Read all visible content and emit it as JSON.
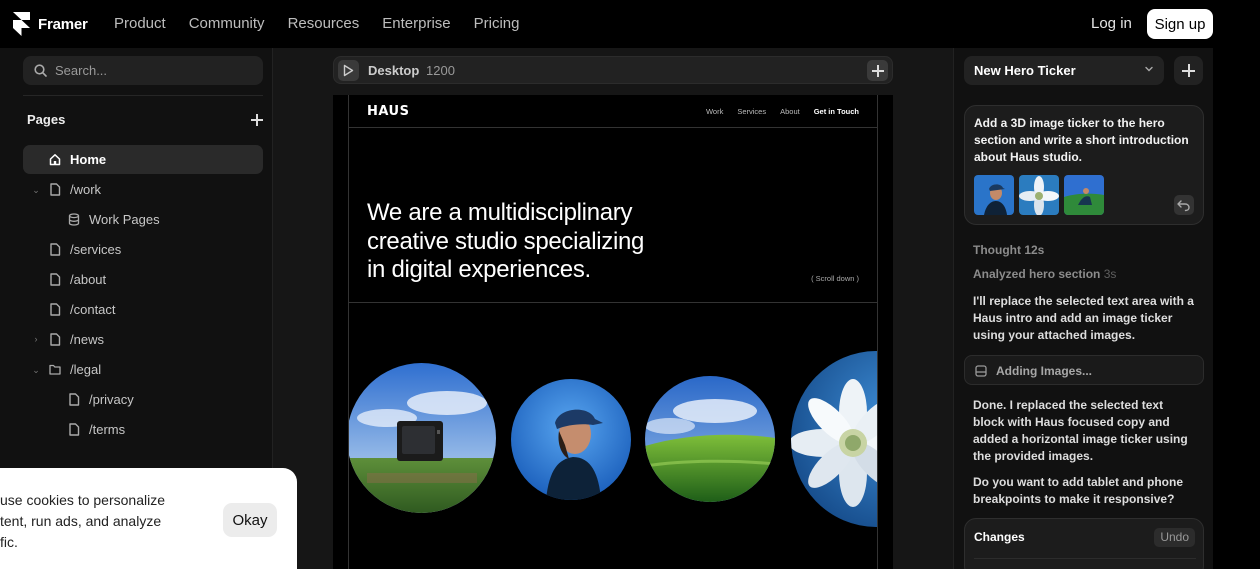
{
  "topnav": {
    "brand": "Framer",
    "links": [
      "Product",
      "Community",
      "Resources",
      "Enterprise",
      "Pricing"
    ],
    "login": "Log in",
    "signup": "Sign up"
  },
  "left_panel": {
    "search_placeholder": "Search...",
    "pages_title": "Pages",
    "items": [
      {
        "label": "Home",
        "icon": "home-icon",
        "active": true
      },
      {
        "label": "/work",
        "icon": "file-icon",
        "expanded": true
      },
      {
        "label": "Work Pages",
        "icon": "database-icon"
      },
      {
        "label": "/services",
        "icon": "file-icon"
      },
      {
        "label": "/about",
        "icon": "file-icon"
      },
      {
        "label": "/contact",
        "icon": "file-icon"
      },
      {
        "label": "/news",
        "icon": "file-icon",
        "expanded": false
      },
      {
        "label": "/legal",
        "icon": "folder-icon",
        "expanded": true
      },
      {
        "label": "/privacy",
        "icon": "file-icon"
      },
      {
        "label": "/terms",
        "icon": "file-icon"
      }
    ]
  },
  "canvas": {
    "breakpoint": "Desktop",
    "width": "1200",
    "site": {
      "logo": "HAUS",
      "nav": [
        "Work",
        "Services",
        "About",
        "Get in Touch"
      ],
      "hero_lines": [
        "We are a multidisciplinary",
        "creative studio specializing",
        "in digital experiences."
      ],
      "scroll_hint": "( Scroll down )"
    }
  },
  "right_panel": {
    "select_label": "New Hero Ticker",
    "prompt": "Add a 3D image ticker to the hero section and write a short introduction about Haus studio.",
    "thought": {
      "label": "Thought",
      "time": "12s"
    },
    "analyzed": {
      "label": "Analyzed hero section",
      "time": "3s"
    },
    "message1": "I'll replace the selected text area with a Haus intro and add an image ticker using your attached images.",
    "adding": "Adding Images...",
    "message2": "Done. I replaced the selected text block with Haus focused copy and added a horizontal image ticker using the provided images.",
    "message3": "Do you want to add tablet and phone breakpoints to make it responsive?",
    "changes_title": "Changes",
    "changes_undo": "Undo"
  },
  "cookie": {
    "lines": [
      "use cookies to personalize",
      "tent, run ads, and analyze",
      "fic."
    ],
    "button": "Okay"
  },
  "colors": {
    "background": "#000000",
    "panel": "#111111",
    "accent": "#ffffff"
  }
}
